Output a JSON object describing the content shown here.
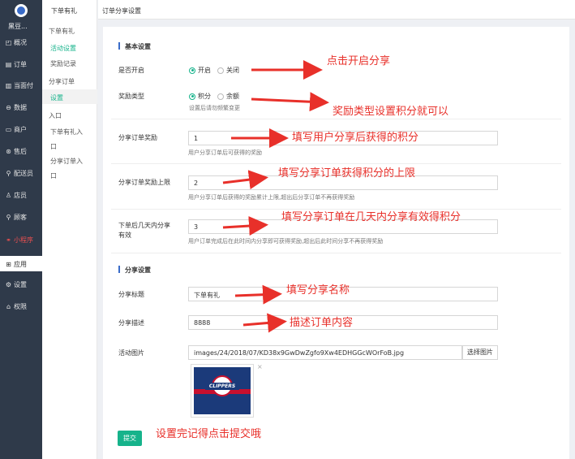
{
  "sidebar": {
    "brand": "黑豆...",
    "items": [
      {
        "icon": "chart-icon",
        "glyph": "◰",
        "label": "概况"
      },
      {
        "icon": "order-icon",
        "glyph": "▤",
        "label": "订单"
      },
      {
        "icon": "pay-icon",
        "glyph": "▥",
        "label": "当面付"
      },
      {
        "icon": "data-icon",
        "glyph": "⊖",
        "label": "数据"
      },
      {
        "icon": "store-icon",
        "glyph": "▭",
        "label": "商户"
      },
      {
        "icon": "aftersale-icon",
        "glyph": "⊛",
        "label": "售后"
      },
      {
        "icon": "delivery-icon",
        "glyph": "⚲",
        "label": "配送员"
      },
      {
        "icon": "clerk-icon",
        "glyph": "♙",
        "label": "店员"
      },
      {
        "icon": "customer-icon",
        "glyph": "⚲",
        "label": "顾客"
      },
      {
        "icon": "miniapp-icon",
        "glyph": "⚭",
        "label": "小程序"
      },
      {
        "icon": "apps-icon",
        "glyph": "⊞",
        "label": "应用"
      },
      {
        "icon": "settings-icon",
        "glyph": "⚙",
        "label": "设置"
      },
      {
        "icon": "permission-icon",
        "glyph": "⌂",
        "label": "权限"
      }
    ]
  },
  "subnav": {
    "title": "下单有礼",
    "items": [
      "下单有礼",
      "活动设置",
      "奖励记录",
      "分享订单",
      "设置",
      "入口",
      "下单有礼入",
      "口",
      "分享订单入",
      "口"
    ]
  },
  "topbar": {
    "title": "订单分享设置"
  },
  "form": {
    "basic_title": "基本设置",
    "enable_label": "是否开启",
    "enable_on": "开启",
    "enable_off": "关闭",
    "reward_type_label": "奖励类型",
    "reward_points": "积分",
    "reward_balance": "余额",
    "reward_type_help": "设置后请勿频繁变更",
    "share_reward_label": "分享订单奖励",
    "share_reward_value": "1",
    "share_reward_help": "用户分享订单后可获得的奖励",
    "reward_limit_label": "分享订单奖励上限",
    "reward_limit_value": "2",
    "reward_limit_help": "用户分享订单后获得的奖励累计上限,超出后分享订单不再获得奖励",
    "days_label_1": "下单后几天内分享",
    "days_label_2": "有效",
    "days_value": "3",
    "days_help": "用户订单完成后在此时间内分享即可获得奖励,超出后此时间分享不再获得奖励",
    "share_title": "分享设置",
    "share_name_label": "分享标题",
    "share_name_value": "下单有礼",
    "share_desc_label": "分享描述",
    "share_desc_value": "8888",
    "image_label": "活动图片",
    "image_path": "images/24/2018/07/KD38x9GwDwZgfo9Xw4EDHGGcWOrFoB.jpg",
    "image_button": "选择图片",
    "image_close": "×",
    "image_logo_text": "CLIPPERS",
    "submit": "提交"
  },
  "annotations": {
    "a1": "点击开启分享",
    "a2": "奖励类型设置积分就可以",
    "a3": "填写用户分享后获得的积分",
    "a4": "填写分享订单获得积分的上限",
    "a5": "填写分享订单在几天内分享有效得积分",
    "a6": "填写分享名称",
    "a7": "描述订单内容",
    "a8": "设置完记得点击提交哦"
  },
  "colors": {
    "accent": "#16b38b",
    "annotation": "#e8302a",
    "sidebar": "#2f3a4a"
  }
}
